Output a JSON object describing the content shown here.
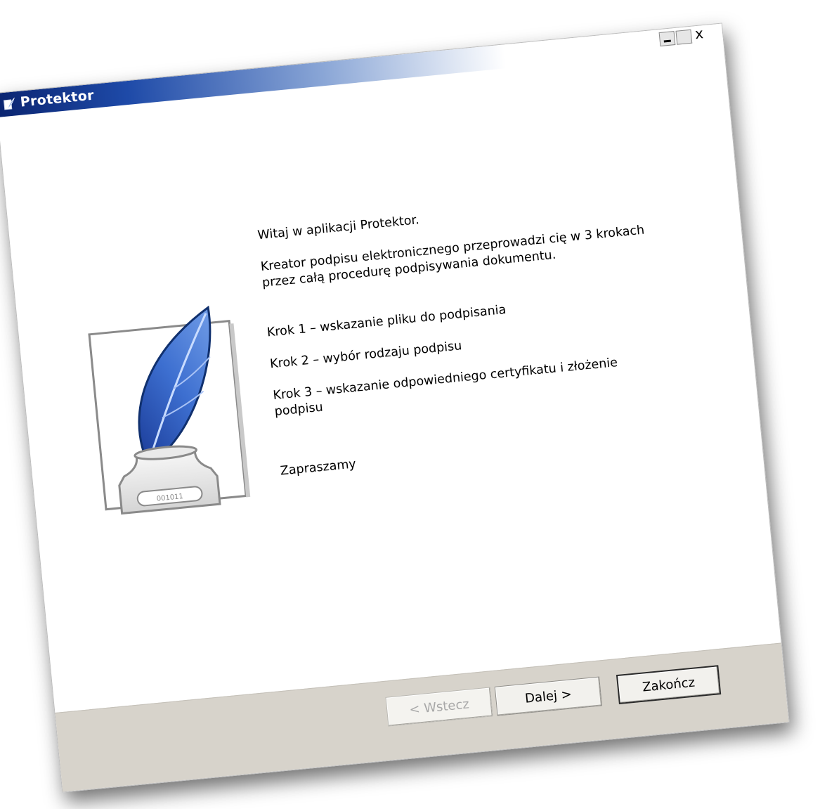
{
  "window": {
    "title": "Protektor",
    "controls": {
      "minimize_icon": "minimize-icon",
      "maximize_icon": "maximize-icon",
      "close_label": "x"
    }
  },
  "illustration": {
    "icon": "quill-inkwell-icon",
    "inkwell_label": "001011"
  },
  "content": {
    "greeting": "Witaj w aplikacji Protektor.",
    "intro": "Kreator podpisu elektronicznego przeprowadzi cię w 3 krokach przez całą procedurę podpisywania dokumentu.",
    "steps": [
      "Krok 1 – wskazanie pliku do podpisania",
      "Krok 2 – wybór rodzaju podpisu",
      "Krok 3 – wskazanie odpowiedniego certyfikatu i złożenie podpisu"
    ],
    "closing": "Zapraszamy"
  },
  "buttons": {
    "back": "< Wstecz",
    "next": "Dalej >",
    "finish": "Zakończ"
  },
  "colors": {
    "titlebar_start": "#0a2470",
    "quill_blue": "#2f5fc4",
    "button_bar": "#d7d3cb"
  }
}
